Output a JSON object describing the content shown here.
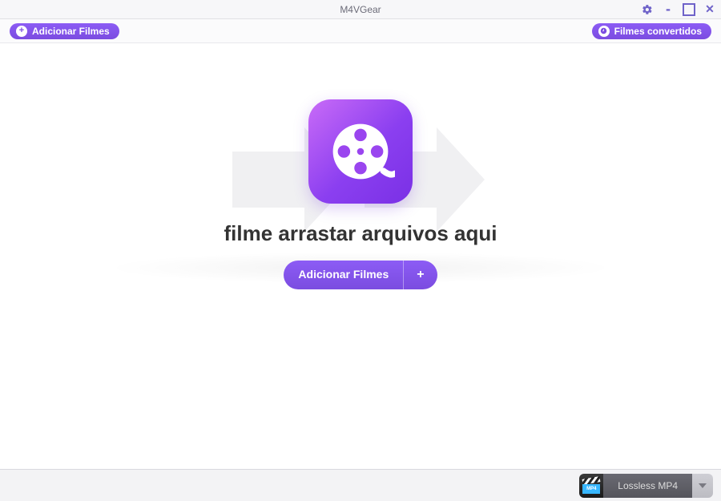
{
  "titlebar": {
    "title": "M4VGear"
  },
  "toolbar": {
    "add_movies_label": "Adicionar Filmes",
    "converted_movies_label": "Filmes convertidos"
  },
  "main": {
    "drop_hint": "filme arrastar arquivos aqui",
    "add_button_label": "Adicionar Filmes"
  },
  "statusbar": {
    "format_label": "Lossless MP4",
    "format_badge": "MP4"
  }
}
